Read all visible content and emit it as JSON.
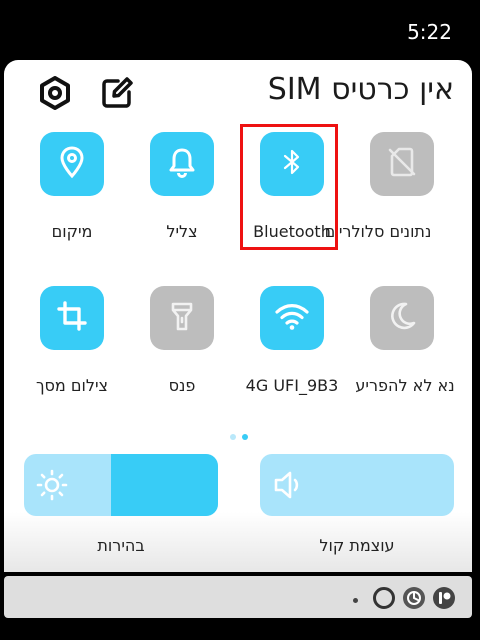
{
  "status_bar": {
    "time": "5:22"
  },
  "header": {
    "title": "אין כרטיס SIM",
    "settings_icon": "settings-icon",
    "edit_icon": "edit-icon"
  },
  "tiles_row1": [
    {
      "label": "מיקום",
      "icon": "location-icon",
      "state": "on"
    },
    {
      "label": "צליל",
      "icon": "bell-icon",
      "state": "on"
    },
    {
      "label": "Bluetooth",
      "icon": "bluetooth-icon",
      "state": "on"
    },
    {
      "label": "נתונים סלולריים",
      "icon": "mobile-data-off-icon",
      "state": "off"
    }
  ],
  "tiles_row2": [
    {
      "label": "צילום מסך",
      "icon": "crop-icon",
      "state": "on"
    },
    {
      "label": "פנס",
      "icon": "flashlight-icon",
      "state": "off"
    },
    {
      "label": "4G UFI_9B3",
      "icon": "wifi-icon",
      "state": "on"
    },
    {
      "label": "נא לא להפריע",
      "icon": "moon-icon",
      "state": "off"
    }
  ],
  "page_indicator": {
    "count": 2,
    "active": 2
  },
  "sliders": {
    "brightness": {
      "label": "בהירות",
      "icon": "brightness-icon",
      "level": 0.55
    },
    "volume": {
      "label": "עוצמת קול",
      "icon": "volume-icon",
      "level": 0.0
    }
  },
  "colors": {
    "accent": "#38ccf6",
    "accent_light": "#a9e4fb",
    "tile_off": "#bdbdbd",
    "highlight": "#e11111"
  },
  "nav_bar": {
    "icons": [
      "notification-dot-icon",
      "ring-icon",
      "sync-icon",
      "app-icon"
    ]
  }
}
